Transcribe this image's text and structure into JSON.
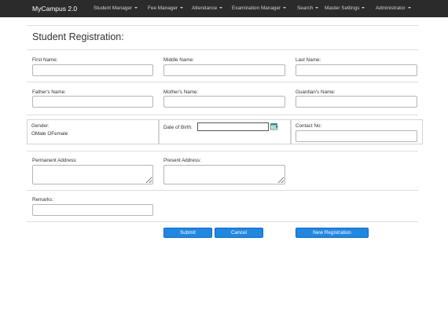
{
  "navbar": {
    "brand": "MyCampus 2.0",
    "items": [
      {
        "label": "Student Manager"
      },
      {
        "label": "Fee Manager"
      },
      {
        "label": "Attendance"
      },
      {
        "label": "Examination Manager"
      },
      {
        "label": "Search"
      },
      {
        "label": "Master Settings"
      },
      {
        "label": "Administrator"
      }
    ]
  },
  "form": {
    "title": "Student Registration:",
    "first_name": {
      "label": "First Name:",
      "value": ""
    },
    "middle_name": {
      "label": "Middle Name:",
      "value": ""
    },
    "last_name": {
      "label": "Last Name:",
      "value": ""
    },
    "fathers_name": {
      "label": "Father's Name:",
      "value": ""
    },
    "mothers_name": {
      "label": "Mother's Name:",
      "value": ""
    },
    "guardians_name": {
      "label": "Guardian's Name:",
      "value": ""
    },
    "gender": {
      "label": "Gender:",
      "options": [
        "Male",
        "Female"
      ],
      "radio_glyph": "O"
    },
    "dob": {
      "label": "Date of Birth:",
      "value": ""
    },
    "contact": {
      "label": "Contact No:",
      "value": ""
    },
    "permanent_address": {
      "label": "Permanent Address:",
      "value": ""
    },
    "present_address": {
      "label": "Present Address:",
      "value": ""
    },
    "remarks": {
      "label": "Remarks:",
      "value": ""
    }
  },
  "buttons": {
    "submit": "Submit",
    "cancel": "Cancel",
    "new_registration": "New Registration"
  },
  "colors": {
    "navbar_bg": "#2b2b2b",
    "button_bg": "#1e88e5"
  },
  "icons": {
    "calendar": "calendar-icon",
    "caret": "caret-down-icon"
  }
}
